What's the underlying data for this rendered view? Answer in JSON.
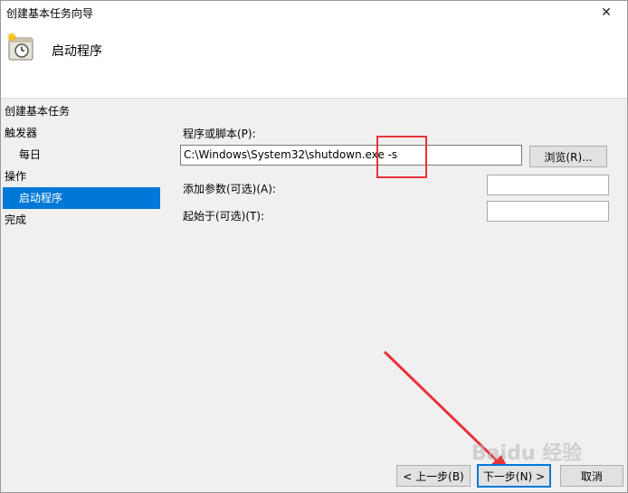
{
  "window": {
    "title": "创建基本任务向导",
    "close_glyph": "✕"
  },
  "header": {
    "title": "启动程序",
    "icon": "clock-calendar-icon"
  },
  "task_section_label": "创建基本任务",
  "sidebar": {
    "items": [
      {
        "label": "触发器"
      },
      {
        "label": "每日"
      },
      {
        "label": "操作"
      },
      {
        "label": "启动程序"
      },
      {
        "label": "完成"
      }
    ],
    "active_color": "#0078d7"
  },
  "form": {
    "program_label": "程序或脚本(P):",
    "program_value": "C:\\Windows\\System32\\shutdown.exe -s",
    "browse_label": "浏览(R)...",
    "args_label": "添加参数(可选)(A):",
    "args_value": "",
    "startin_label": "起始于(可选)(T):",
    "startin_value": ""
  },
  "footer": {
    "back_label": "< 上一步(B)",
    "next_label": "下一步(N) >",
    "cancel_label": "取消"
  },
  "annotation": {
    "highlight_color": "#e8333a"
  },
  "watermark": {
    "text": "Baidu 经验"
  }
}
